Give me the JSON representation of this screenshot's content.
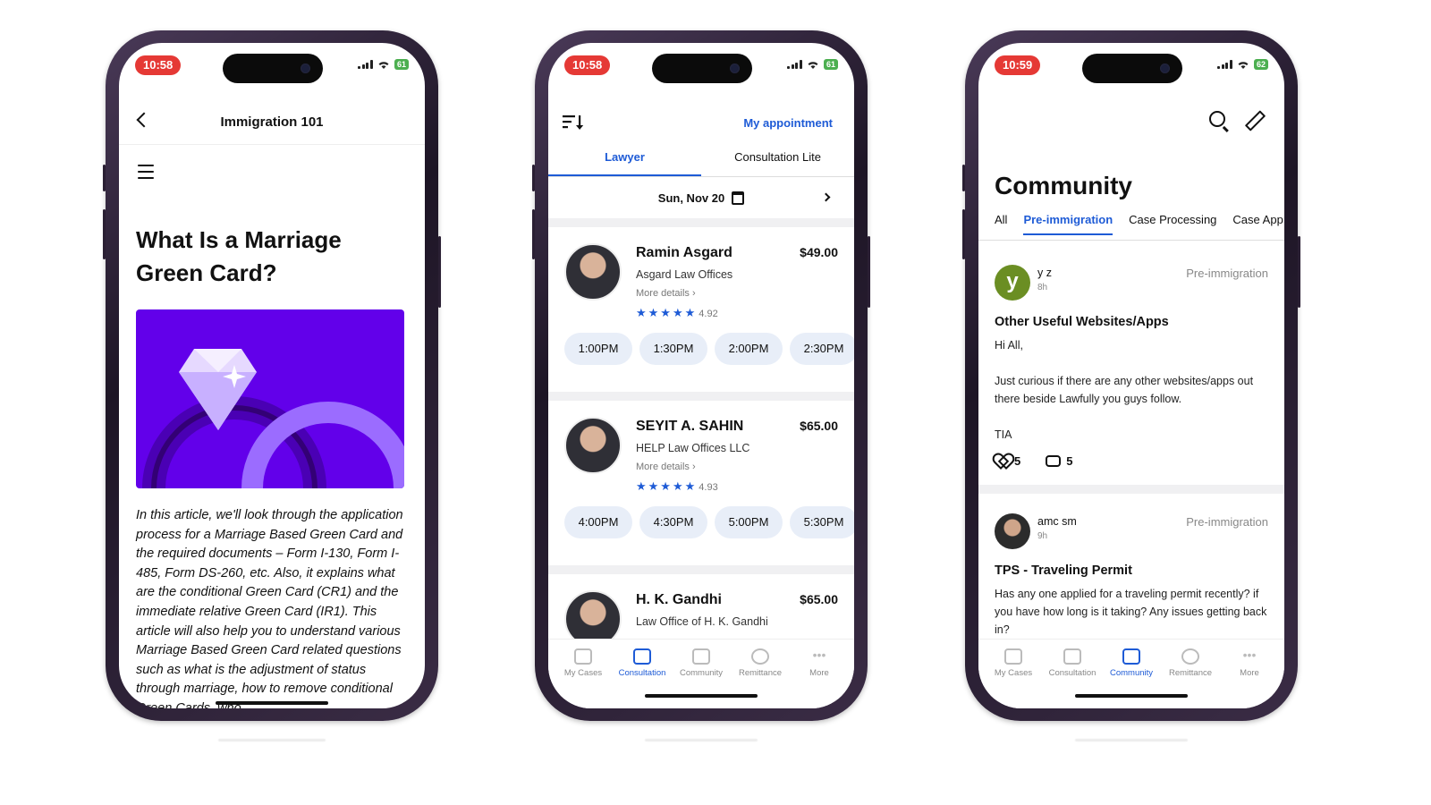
{
  "phones": [
    {
      "status": {
        "time": "10:58",
        "battery": "61"
      },
      "header": {
        "title": "Immigration 101"
      },
      "article": {
        "title": "What Is a Marriage Green Card?",
        "body": "In this article, we'll look through the application process for a Marriage Based Green Card and the required documents – Form I-130, Form I-485, Form DS-260, etc. Also, it explains what are the conditional Green Card (CR1) and the immediate relative Green Card (IR1). This article will also help you to understand various Marriage Based Green Card related questions such as what is the adjustment of status through marriage, how to remove conditional Green Cards, who"
      },
      "colors": {
        "hero_bg": "#6200ea"
      }
    },
    {
      "status": {
        "time": "10:58",
        "battery": "61"
      },
      "header": {
        "my_appointment": "My appointment"
      },
      "tabs": [
        "Lawyer",
        "Consultation Lite"
      ],
      "date": "Sun, Nov 20",
      "lawyers": [
        {
          "name": "Ramin Asgard",
          "price": "$49.00",
          "firm": "Asgard Law Offices",
          "more": "More details",
          "rating": "4.92",
          "slots": [
            "1:00PM",
            "1:30PM",
            "2:00PM",
            "2:30PM"
          ]
        },
        {
          "name": "SEYIT A. SAHIN",
          "price": "$65.00",
          "firm": "HELP Law Offices LLC",
          "more": "More details",
          "rating": "4.93",
          "slots": [
            "4:00PM",
            "4:30PM",
            "5:00PM",
            "5:30PM"
          ]
        },
        {
          "name": "H. K. Gandhi",
          "price": "$65.00",
          "firm": "Law Office of H. K. Gandhi"
        }
      ],
      "nav": [
        "My Cases",
        "Consultation",
        "Community",
        "Remittance",
        "More"
      ],
      "colors": {
        "accent": "#1e5bd6"
      }
    },
    {
      "status": {
        "time": "10:59",
        "battery": "62"
      },
      "title": "Community",
      "tabs": [
        "All",
        "Pre-immigration",
        "Case Processing",
        "Case App"
      ],
      "posts": [
        {
          "avatar_letter": "y",
          "user": "y z",
          "time": "8h",
          "category": "Pre-immigration",
          "title": "Other Useful Websites/Apps",
          "body": "Hi All,\n\nJust curious if there are any other websites/apps out there beside Lawfully you guys follow.\n\nTIA",
          "likes": "5",
          "comments": "5"
        },
        {
          "user": "amc sm",
          "time": "9h",
          "category": "Pre-immigration",
          "title": "TPS - Traveling Permit",
          "body": "Has any one applied for a traveling permit recently? if you have how long is it taking? Any issues getting back in?"
        }
      ],
      "nav": [
        "My Cases",
        "Consultation",
        "Community",
        "Remittance",
        "More"
      ]
    }
  ]
}
